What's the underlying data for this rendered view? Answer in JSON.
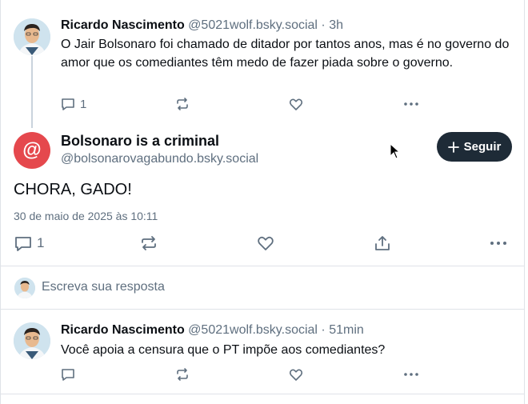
{
  "parent_post": {
    "author_name": "Ricardo Nascimento",
    "author_handle": "@5021wolf.bsky.social",
    "time": "· 3h",
    "text": "O Jair Bolsonaro foi chamado de ditador por tantos anos, mas é no governo do amor que os comediantes têm medo de fazer piada sobre o governo.",
    "reply_count": "1",
    "icons": [
      "reply-icon",
      "repost-icon",
      "like-icon",
      "more-icon"
    ]
  },
  "main_post": {
    "author_name": "Bolsonaro is a criminal",
    "author_handle": "@bolsonarovagabundo.bsky.social",
    "avatar_glyph": "@",
    "avatar_color": "#e5484d",
    "follow_label": "Seguir",
    "text": "CHORA, GADO!",
    "date": "30 de maio de 2025 às 10:11",
    "reply_count": "1",
    "icons": [
      "reply-icon",
      "repost-icon",
      "like-icon",
      "share-icon",
      "more-icon"
    ]
  },
  "reply_composer": {
    "placeholder": "Escreva sua resposta"
  },
  "reply_post": {
    "author_name": "Ricardo Nascimento",
    "author_handle": "@5021wolf.bsky.social",
    "time": "· 51min",
    "text": "Você apoia a censura que o PT impõe aos comediantes?",
    "icons": [
      "reply-icon",
      "repost-icon",
      "like-icon",
      "more-icon"
    ]
  },
  "colors": {
    "follow_button": "#1e2b37",
    "muted_text": "#5f6f7f",
    "divider": "#dfe3e8"
  }
}
